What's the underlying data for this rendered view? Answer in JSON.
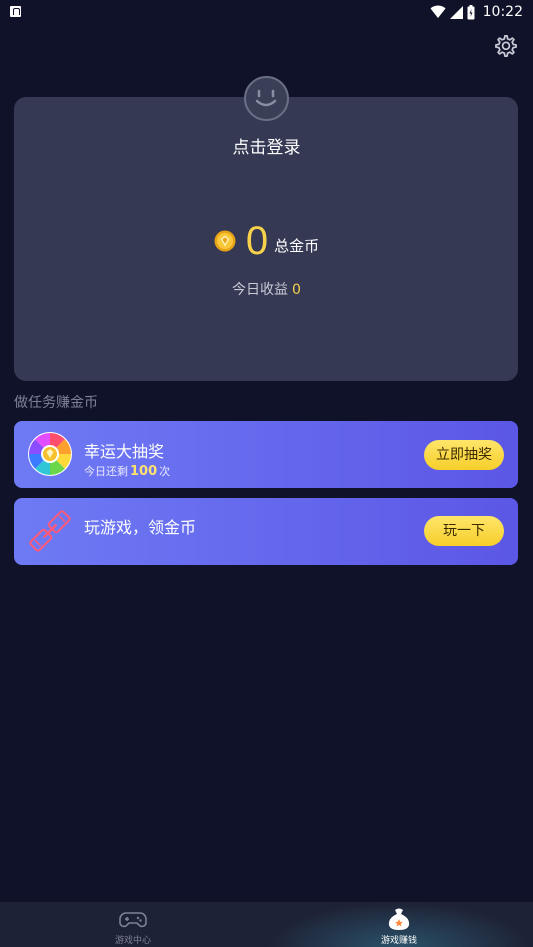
{
  "status_bar": {
    "time": "10:22",
    "icons": [
      "app-notification-icon",
      "wifi-icon",
      "signal-icon",
      "battery-icon"
    ]
  },
  "header": {
    "settings_icon": "gear-icon"
  },
  "login_card": {
    "avatar_icon": "face-avatar-icon",
    "login_text": "点击登录",
    "coin_icon": "gold-coin-icon",
    "total_coins": "0",
    "total_coins_label": "总金币",
    "today_label": "今日收益",
    "today_value": "0"
  },
  "tasks": {
    "section_title": "做任务赚金币",
    "items": [
      {
        "icon": "lucky-wheel-icon",
        "title": "幸运大抽奖",
        "subtitle_prefix": "今日还剩",
        "subtitle_count": "100",
        "subtitle_suffix": "次",
        "button_label": "立即抽奖"
      },
      {
        "icon": "game-link-icon",
        "title": "玩游戏，领金币",
        "button_label": "玩一下"
      }
    ]
  },
  "bottom_nav": {
    "items": [
      {
        "label": "游戏中心",
        "icon": "gamepad-icon",
        "active": false
      },
      {
        "label": "游戏赚钱",
        "icon": "money-bag-icon",
        "active": true
      }
    ]
  },
  "colors": {
    "background": "#0f1229",
    "card": "#353954",
    "accent_gold": "#f7d24a",
    "task_gradient_start": "#6e7af4",
    "task_gradient_end": "#5c57e6",
    "nav_background": "#1e2236"
  }
}
